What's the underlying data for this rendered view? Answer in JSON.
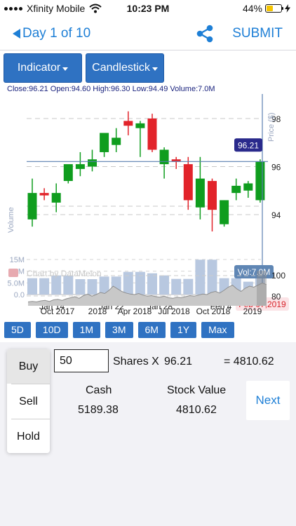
{
  "status": {
    "carrier": "Xfinity Mobile",
    "time": "10:23 PM",
    "battery": "44%",
    "battery_level": 0.44
  },
  "nav": {
    "back_label": "Day 1 of 10",
    "share_icon": "share-icon",
    "submit_label": "SUBMIT"
  },
  "toolbar": {
    "indicator_label": "Indicator",
    "chart_type_label": "Candlestick"
  },
  "ohlc_text": "Close:96.21 Open:94.60 High:96.30 Low:94.49 Volume:7.0M",
  "chart_data": {
    "type": "candlestick",
    "price_axis_label": "Price ($)",
    "volume_axis_label": "Volume",
    "price_ticks": [
      "98",
      "96",
      "94"
    ],
    "volume_ticks": [
      "15M",
      "10M",
      "5.0M",
      "0.0"
    ],
    "x_ticks": [
      "Jan 14",
      "Jan 22",
      "Jan 28",
      "Feb 4"
    ],
    "last_close_label": "96.21",
    "volume_label": "Vol:7.0M",
    "date_label": "Feb 07,2019",
    "watermark": "Chart by DataMelon",
    "candles": [
      {
        "o": 93.8,
        "h": 95.5,
        "l": 93.5,
        "c": 94.9,
        "v": 7.0
      },
      {
        "o": 94.9,
        "h": 95.1,
        "l": 94.6,
        "c": 94.8,
        "v": 7.0
      },
      {
        "o": 94.5,
        "h": 95.3,
        "l": 94.1,
        "c": 94.9,
        "v": 8.2
      },
      {
        "o": 95.4,
        "h": 95.8,
        "l": 95.3,
        "c": 96.1,
        "v": 8.2
      },
      {
        "o": 95.9,
        "h": 96.6,
        "l": 95.6,
        "c": 96.1,
        "v": 6.6
      },
      {
        "o": 96.0,
        "h": 96.7,
        "l": 95.8,
        "c": 96.3,
        "v": 6.6
      },
      {
        "o": 96.6,
        "h": 97.3,
        "l": 96.4,
        "c": 97.4,
        "v": 7.7
      },
      {
        "o": 96.9,
        "h": 97.6,
        "l": 96.6,
        "c": 97.2,
        "v": 7.7
      },
      {
        "o": 97.9,
        "h": 98.3,
        "l": 97.3,
        "c": 97.7,
        "v": 9.7
      },
      {
        "o": 97.6,
        "h": 97.9,
        "l": 96.4,
        "c": 97.8,
        "v": 9.7
      },
      {
        "o": 98.0,
        "h": 98.2,
        "l": 96.6,
        "c": 96.7,
        "v": 9.1
      },
      {
        "o": 96.1,
        "h": 96.8,
        "l": 95.5,
        "c": 96.7,
        "v": 8.2
      },
      {
        "o": 96.3,
        "h": 96.4,
        "l": 95.9,
        "c": 96.2,
        "v": 6.7
      },
      {
        "o": 96.1,
        "h": 96.4,
        "l": 94.2,
        "c": 94.6,
        "v": 6.7
      },
      {
        "o": 94.3,
        "h": 96.4,
        "l": 93.8,
        "c": 95.5,
        "v": 14.9
      },
      {
        "o": 95.4,
        "h": 95.5,
        "l": 93.3,
        "c": 94.2,
        "v": 14.9
      },
      {
        "o": 93.6,
        "h": 94.6,
        "l": 93.5,
        "c": 94.6,
        "v": 7.0
      },
      {
        "o": 94.9,
        "h": 95.5,
        "l": 94.6,
        "c": 95.2,
        "v": 7.0
      },
      {
        "o": 95.0,
        "h": 95.4,
        "l": 94.7,
        "c": 95.3,
        "v": 5.5
      },
      {
        "o": 94.6,
        "h": 96.3,
        "l": 94.5,
        "c": 96.2,
        "v": 7.0
      }
    ],
    "volume_max": 15,
    "overview_ticks_x": [
      "Oct 2017",
      "2018",
      "Apr 2018",
      "Jul 2018",
      "Oct 2018",
      "2019"
    ],
    "overview_ticks_y": [
      "100",
      "80"
    ]
  },
  "ranges": [
    "5D",
    "10D",
    "1M",
    "3M",
    "6M",
    "1Y",
    "Max"
  ],
  "trade": {
    "quantity": "50",
    "shares_x_label": "Shares X",
    "price": "96.21",
    "equals_total": "= 4810.62",
    "cash_label": "Cash",
    "cash_value": "5189.38",
    "stock_value_label": "Stock Value",
    "stock_value": "4810.62",
    "next_label": "Next"
  },
  "menu": {
    "items": [
      "Buy",
      "Sell",
      "Hold"
    ],
    "selected": "Buy"
  },
  "colors": {
    "up": "#0f9d1e",
    "down": "#e2232a",
    "accent": "#1e7fd6",
    "button": "#2f72c2",
    "volume": "#b8c8e0",
    "tag": "#2a2a8c"
  }
}
